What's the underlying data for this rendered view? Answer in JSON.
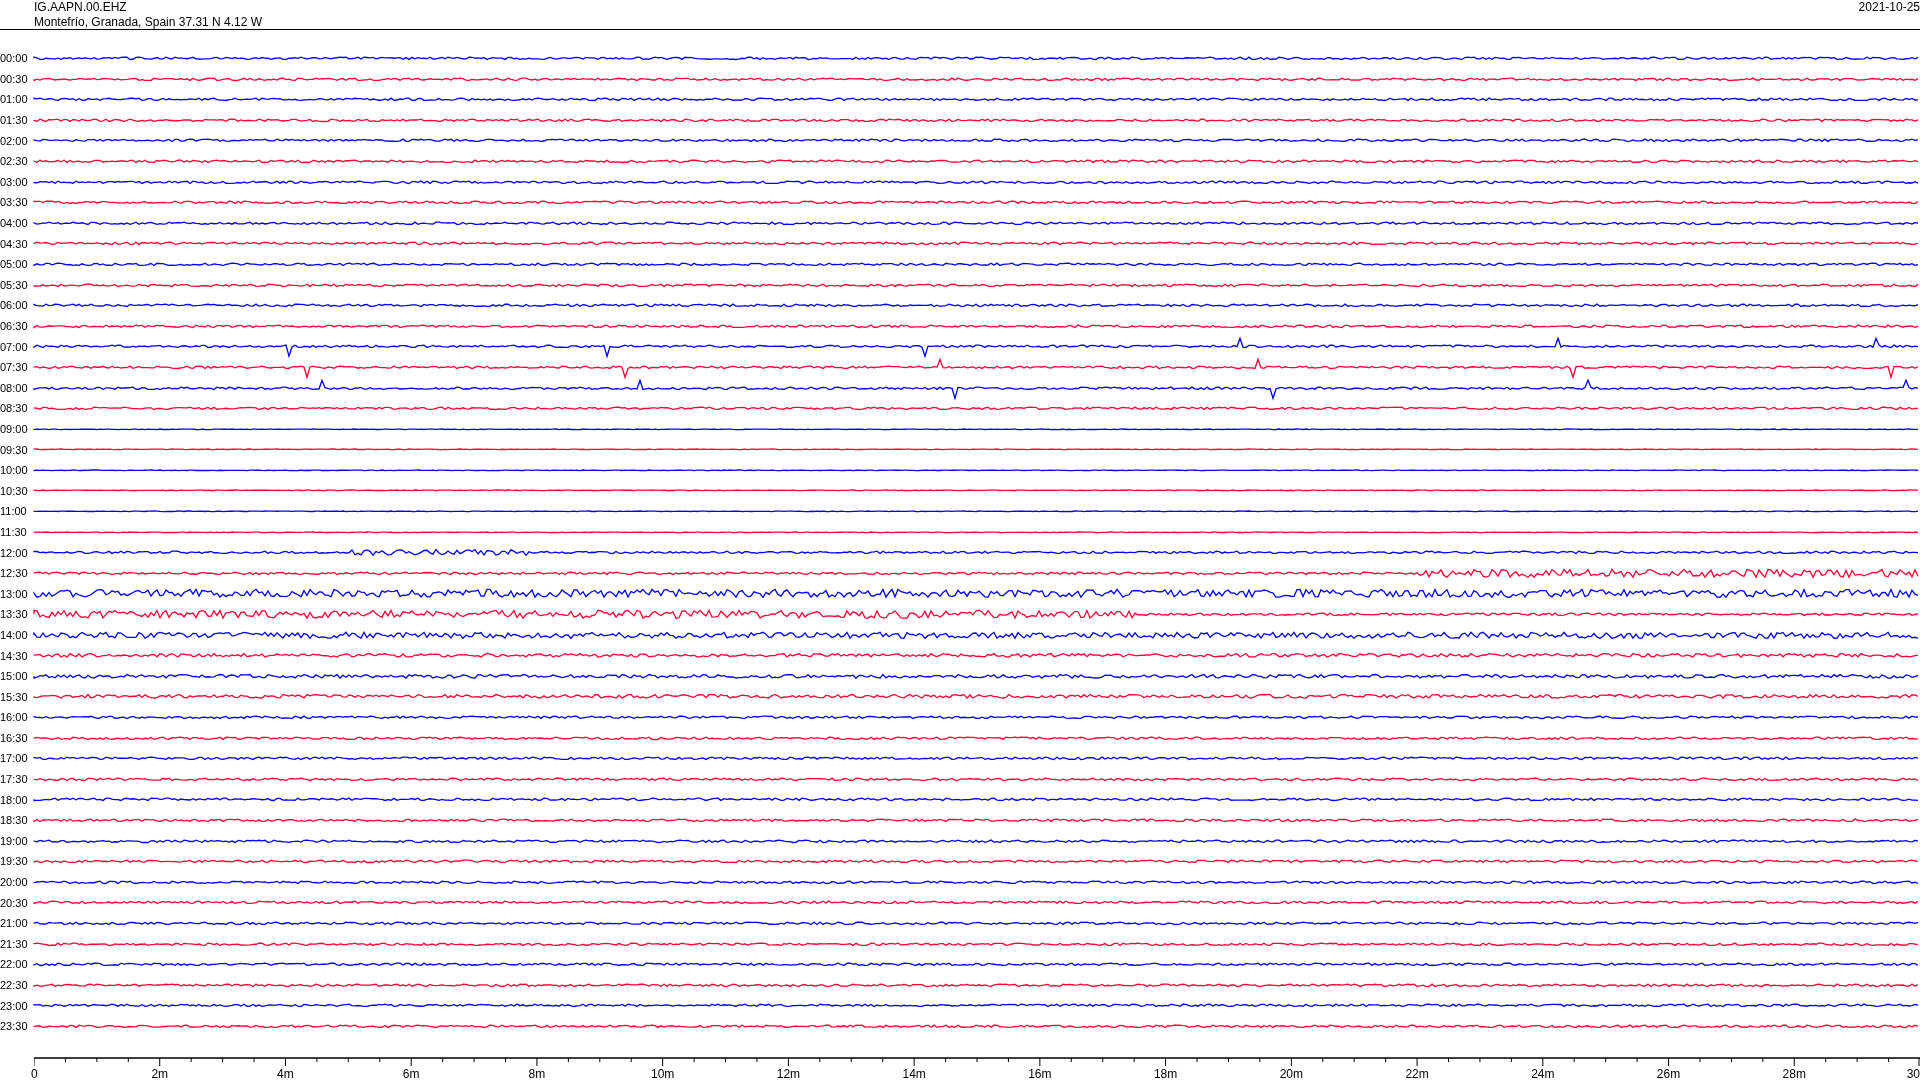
{
  "header": {
    "station": "IG.AAPN.00.EHZ",
    "location": "Montefrío, Granada, Spain  37.31 N 4.12 W",
    "date": "2021-10-25"
  },
  "traces": [
    {
      "label": "00:00",
      "color": "#0000ff"
    },
    {
      "label": "00:30",
      "color": "#ff0033"
    },
    {
      "label": "01:00",
      "color": "#0000ff"
    },
    {
      "label": "01:30",
      "color": "#ff0033"
    },
    {
      "label": "02:00",
      "color": "#0000ff"
    },
    {
      "label": "02:30",
      "color": "#ff0033"
    },
    {
      "label": "03:00",
      "color": "#0000ff"
    },
    {
      "label": "03:30",
      "color": "#ff0033"
    },
    {
      "label": "04:00",
      "color": "#0000ff"
    },
    {
      "label": "04:30",
      "color": "#ff0033"
    },
    {
      "label": "05:00",
      "color": "#0000ff"
    },
    {
      "label": "05:30",
      "color": "#ff0033"
    },
    {
      "label": "06:00",
      "color": "#0000ff"
    },
    {
      "label": "06:30",
      "color": "#ff0033"
    },
    {
      "label": "07:00",
      "color": "#0000ff"
    },
    {
      "label": "07:30",
      "color": "#ff0033"
    },
    {
      "label": "08:00",
      "color": "#0000ff"
    },
    {
      "label": "08:30",
      "color": "#ff0033"
    },
    {
      "label": "09:00",
      "color": "#0000ff"
    },
    {
      "label": "09:30",
      "color": "#ff0033"
    },
    {
      "label": "10:00",
      "color": "#0000ff"
    },
    {
      "label": "10:30",
      "color": "#ff0033"
    },
    {
      "label": "11:00",
      "color": "#0000ff"
    },
    {
      "label": "11:30",
      "color": "#ff0033"
    },
    {
      "label": "12:00",
      "color": "#0000ff"
    },
    {
      "label": "12:30",
      "color": "#ff0033"
    },
    {
      "label": "13:00",
      "color": "#0000ff"
    },
    {
      "label": "13:30",
      "color": "#ff0033"
    },
    {
      "label": "14:00",
      "color": "#0000ff"
    },
    {
      "label": "14:30",
      "color": "#ff0033"
    },
    {
      "label": "15:00",
      "color": "#0000ff"
    },
    {
      "label": "15:30",
      "color": "#ff0033"
    },
    {
      "label": "16:00",
      "color": "#0000ff"
    },
    {
      "label": "16:30",
      "color": "#ff0033"
    },
    {
      "label": "17:00",
      "color": "#0000ff"
    },
    {
      "label": "17:30",
      "color": "#ff0033"
    },
    {
      "label": "18:00",
      "color": "#0000ff"
    },
    {
      "label": "18:30",
      "color": "#ff0033"
    },
    {
      "label": "19:00",
      "color": "#0000ff"
    },
    {
      "label": "19:30",
      "color": "#ff0033"
    },
    {
      "label": "20:00",
      "color": "#0000ff"
    },
    {
      "label": "20:30",
      "color": "#ff0033"
    },
    {
      "label": "21:00",
      "color": "#0000ff"
    },
    {
      "label": "21:30",
      "color": "#ff0033"
    },
    {
      "label": "22:00",
      "color": "#0000ff"
    },
    {
      "label": "22:30",
      "color": "#ff0033"
    },
    {
      "label": "23:00",
      "color": "#0000ff"
    },
    {
      "label": "23:30",
      "color": "#ff0033"
    }
  ],
  "x_axis": {
    "ticks": [
      "0",
      "2m",
      "4m",
      "6m",
      "8m",
      "10m",
      "12m",
      "14m",
      "16m",
      "18m",
      "20m",
      "22m",
      "24m",
      "26m",
      "28m",
      "30"
    ]
  }
}
